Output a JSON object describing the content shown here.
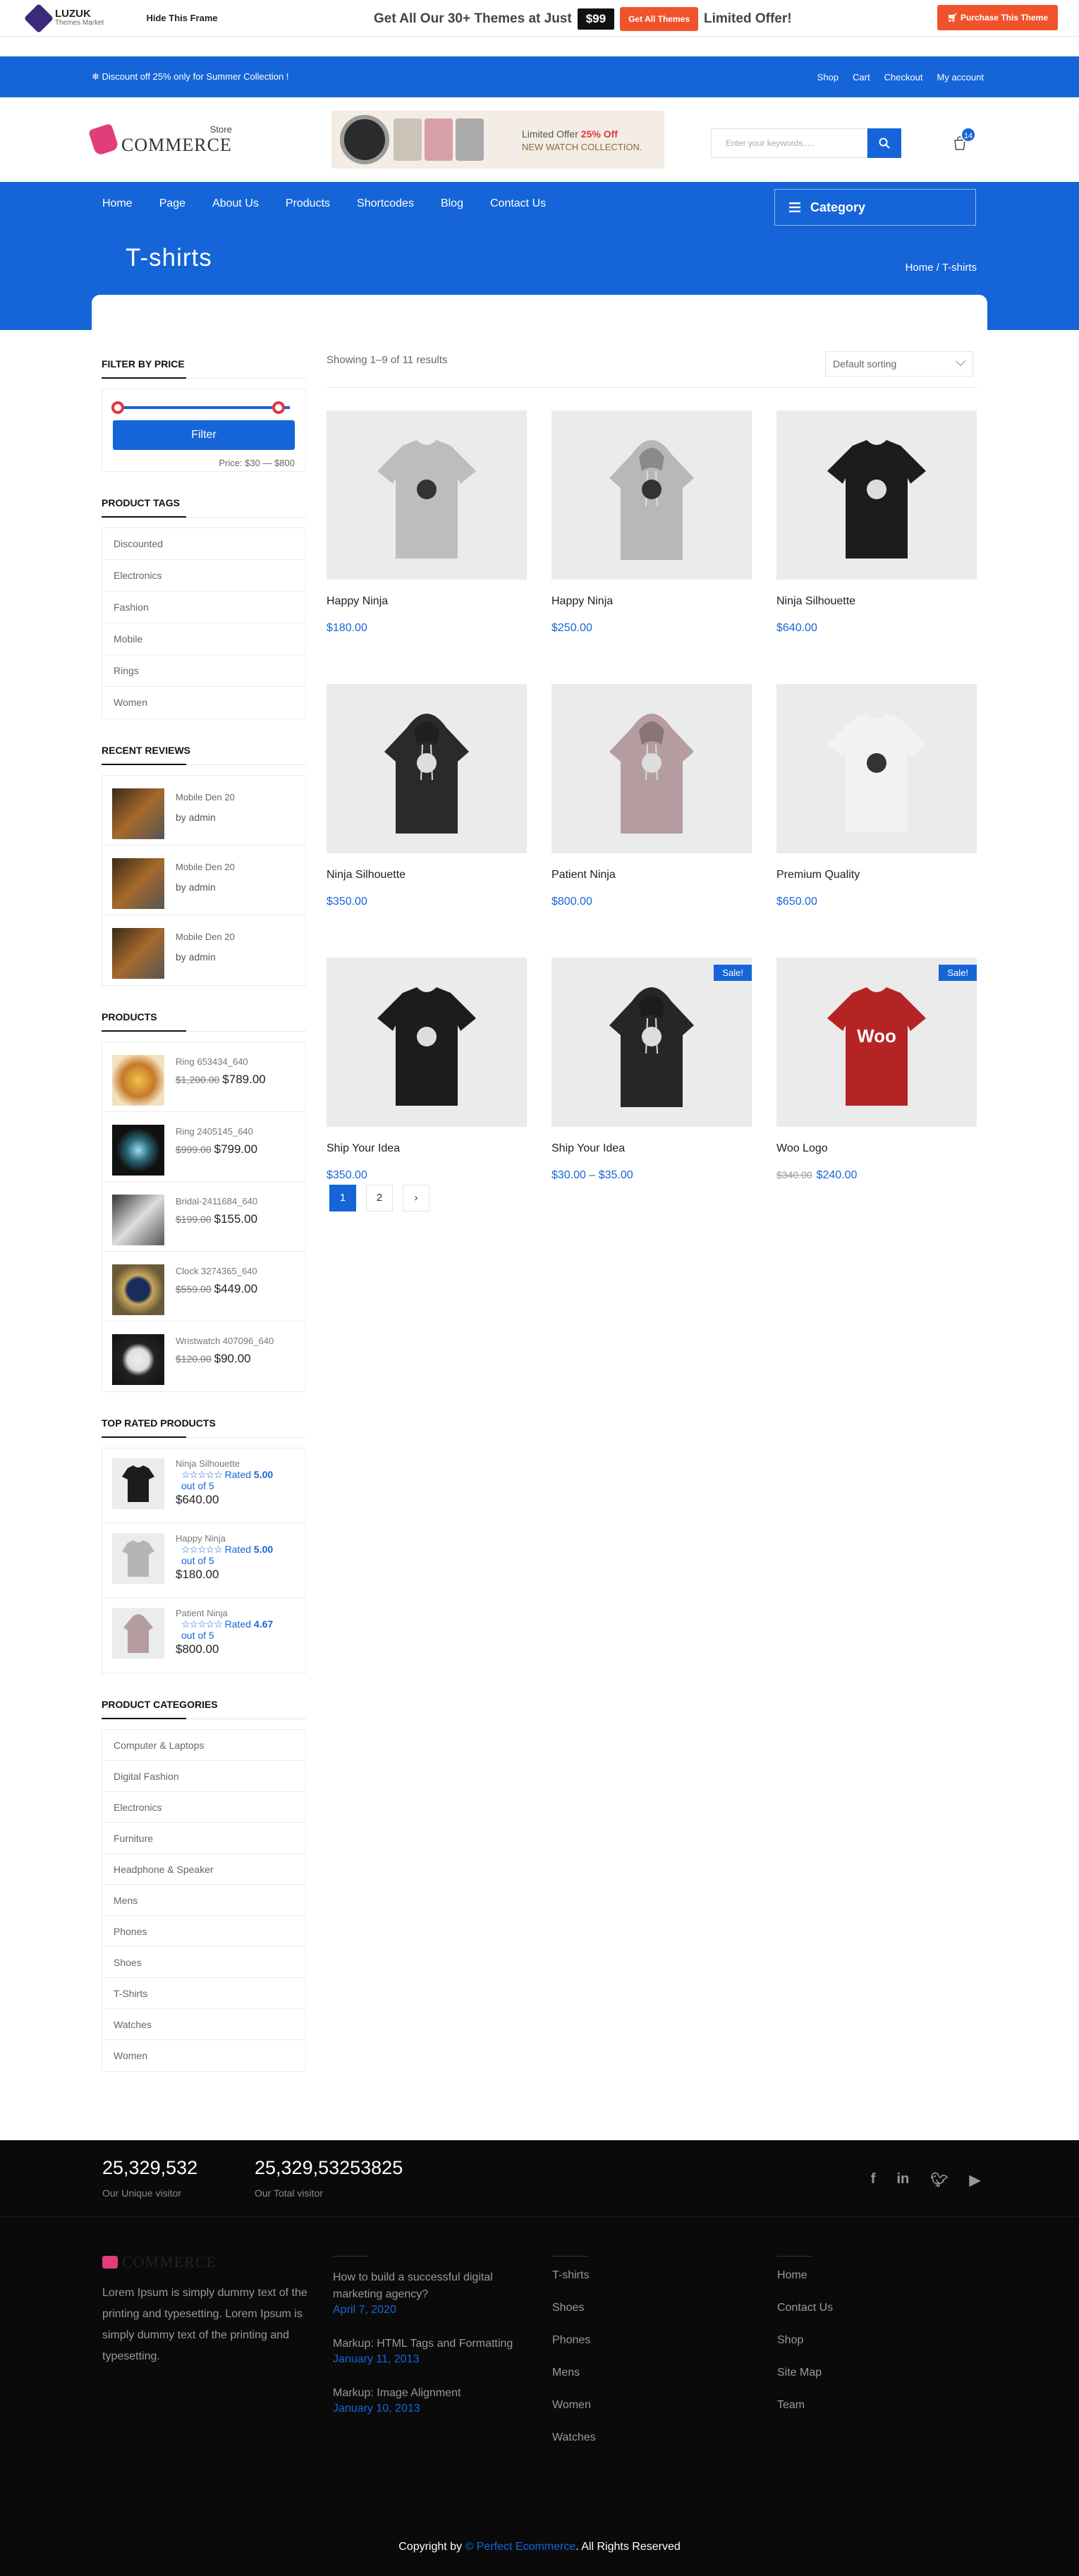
{
  "promo": {
    "logo_name": "LUZUK",
    "logo_sub": "Themes Market",
    "hide_frame": "Hide This Frame",
    "headline": "Get All Our 30+ Themes at Just",
    "price": "$99",
    "get_all": "Get All Themes",
    "limited": "Limited Offer!",
    "purchase": "Purchase This Theme"
  },
  "topbar": {
    "announcement": "Discount off 25% only for Summer Collection !",
    "links": [
      "Shop",
      "Cart",
      "Checkout",
      "My account"
    ]
  },
  "header": {
    "logo_store": "Store",
    "logo_name": "COMMERCE",
    "banner_line1_prefix": "Limited Offer",
    "banner_discount": "25% Off",
    "banner_line2": "NEW WATCH COLLECTION.",
    "search_placeholder": "Enter your keywords.....",
    "cart_count": "14"
  },
  "nav": {
    "items": [
      "Home",
      "Page",
      "About Us",
      "Products",
      "Shortcodes",
      "Blog",
      "Contact Us"
    ],
    "category": "Category"
  },
  "page": {
    "title": "T-shirts",
    "breadcrumb": "Home / T-shirts"
  },
  "sidebar": {
    "filter_title": "FILTER BY PRICE",
    "filter_button": "Filter",
    "price_label": "Price: $30 — $800",
    "price_min_fraction": 0,
    "price_max_fraction": 1,
    "tags_title": "PRODUCT TAGS",
    "tags": [
      "Discounted",
      "Electronics",
      "Fashion",
      "Mobile",
      "Rings",
      "Women"
    ],
    "reviews_title": "RECENT REVIEWS",
    "reviews": [
      {
        "name": "Mobile Den 20",
        "by": "by admin"
      },
      {
        "name": "Mobile Den 20",
        "by": "by admin"
      },
      {
        "name": "Mobile Den 20",
        "by": "by admin"
      }
    ],
    "products_title": "PRODUCTS",
    "products": [
      {
        "name": "Ring 653434_640",
        "old": "$1,200.00",
        "price": "$789.00"
      },
      {
        "name": "Ring 2405145_640",
        "old": "$999.00",
        "price": "$799.00"
      },
      {
        "name": "Bridal-2411684_640",
        "old": "$199.00",
        "price": "$155.00"
      },
      {
        "name": "Clock 3274365_640",
        "old": "$559.00",
        "price": "$449.00"
      },
      {
        "name": "Wristwatch 407096_640",
        "old": "$120.00",
        "price": "$90.00"
      }
    ],
    "top_title": "TOP RATED PRODUCTS",
    "top_rated": [
      {
        "name": "Ninja Silhouette",
        "rated_prefix": "Rated",
        "rating": "5.00",
        "out_of": "out of 5",
        "price": "$640.00"
      },
      {
        "name": "Happy Ninja",
        "rated_prefix": "Rated",
        "rating": "5.00",
        "out_of": "out of 5",
        "price": "$180.00"
      },
      {
        "name": "Patient Ninja",
        "rated_prefix": "Rated",
        "rating": "4.67",
        "out_of": "out of 5",
        "price": "$800.00"
      }
    ],
    "categories_title": "PRODUCT CATEGORIES",
    "categories": [
      "Computer & Laptops",
      "Digital Fashion",
      "Electronics",
      "Furniture",
      "Headphone & Speaker",
      "Mens",
      "Phones",
      "Shoes",
      "T-Shirts",
      "Watches",
      "Women"
    ]
  },
  "shop": {
    "result_count": "Showing 1–9 of 11 results",
    "sort": "Default sorting",
    "products": [
      {
        "name": "Happy Ninja",
        "price": "$180.00",
        "old": "",
        "sale": "",
        "kind": "tee",
        "color": "#bdbdbd"
      },
      {
        "name": "Happy Ninja",
        "price": "$250.00",
        "old": "",
        "sale": "",
        "kind": "hoodie",
        "color": "#b8b8b8"
      },
      {
        "name": "Ninja Silhouette",
        "price": "$640.00",
        "old": "",
        "sale": "",
        "kind": "tee",
        "color": "#1c1c1c"
      },
      {
        "name": "Ninja Silhouette",
        "price": "$350.00",
        "old": "",
        "sale": "",
        "kind": "hoodie",
        "color": "#2a2a2a"
      },
      {
        "name": "Patient Ninja",
        "price": "$800.00",
        "old": "",
        "sale": "",
        "kind": "hoodie",
        "color": "#b49ca0"
      },
      {
        "name": "Premium Quality",
        "price": "$650.00",
        "old": "",
        "sale": "",
        "kind": "tee",
        "color": "#f2f2f2"
      },
      {
        "name": "Ship Your Idea",
        "price": "$350.00",
        "old": "",
        "sale": "",
        "kind": "tee",
        "color": "#1c1c1c"
      },
      {
        "name": "Ship Your Idea",
        "price": "$30.00 – $35.00",
        "old": "",
        "sale": "Sale!",
        "kind": "hoodie",
        "color": "#262626"
      },
      {
        "name": "Woo Logo",
        "price": "$240.00",
        "old": "$340.00",
        "sale": "Sale!",
        "kind": "tee",
        "color": "#b52424",
        "print": "Woo"
      }
    ],
    "pages": [
      "1",
      "2",
      "›"
    ]
  },
  "footer": {
    "counter1": "25,329,532",
    "counter1_label": "Our Unique visitor",
    "counter2": "25,329,53253825",
    "counter2_label": "Our Total visitor",
    "about": "Lorem Ipsum is simply dummy text of the printing and typesetting. Lorem Ipsum is simply dummy text of the printing and typesetting.",
    "logo": "COMMERCE",
    "posts": [
      {
        "title": "How to build a successful digital marketing agency?",
        "date": "April 7, 2020"
      },
      {
        "title": "Markup: HTML Tags and Formatting",
        "date": "January 11, 2013"
      },
      {
        "title": "Markup: Image Alignment",
        "date": "January 10, 2013"
      }
    ],
    "cats": [
      "T-shirts",
      "Shoes",
      "Phones",
      "Mens",
      "Women",
      "Watches"
    ],
    "links": [
      "Home",
      "Contact Us",
      "Shop",
      "Site Map",
      "Team"
    ],
    "copy_prefix": "Copyright by",
    "copy_brand": "Perfect Ecommerce",
    "copy_suffix": ". All Rights Reserved",
    "social": [
      "facebook-icon",
      "linkedin-icon",
      "twitter-icon",
      "youtube-icon"
    ]
  },
  "colors": {
    "brand": "#1565d8",
    "accent": "#f0532b",
    "pink": "#e23d7b"
  }
}
